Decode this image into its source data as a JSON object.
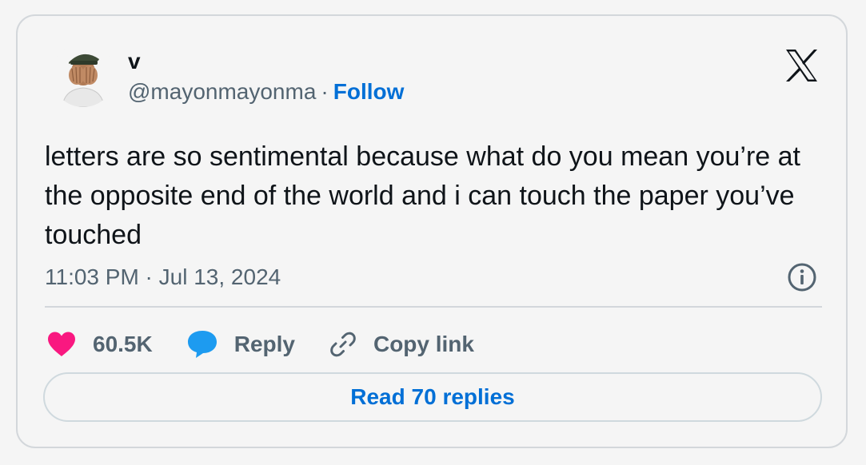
{
  "tweet": {
    "author_name": "v",
    "handle": "@mayonmayonma",
    "separator": "·",
    "follow_label": "Follow",
    "text": "letters are so sentimental because what do you mean you’re at the opposite end of the world and i can touch the paper you’ve touched",
    "timestamp": "11:03 PM · Jul 13, 2024"
  },
  "actions": {
    "likes": {
      "icon": "heart-icon",
      "label": "60.5K",
      "color": "#f91880"
    },
    "reply": {
      "icon": "speech-bubble-icon",
      "label": "Reply",
      "color": "#1d9bf0"
    },
    "copy_link": {
      "icon": "link-icon",
      "label": "Copy link"
    }
  },
  "footer": {
    "read_replies_label": "Read 70 replies"
  },
  "colors": {
    "accent": "#006fd6",
    "muted_text": "#536471",
    "border": "#d3d7db",
    "background": "#f5f5f5"
  }
}
